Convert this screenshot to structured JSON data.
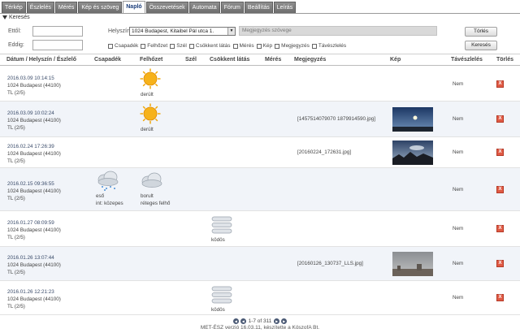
{
  "tabs": [
    {
      "label": "Térkép",
      "active": false
    },
    {
      "label": "Észlelés",
      "active": false
    },
    {
      "label": "Mérés",
      "active": false
    },
    {
      "label": "Kép és szöveg",
      "active": false
    },
    {
      "label": "Napló",
      "active": true
    },
    {
      "label": "Összevetések",
      "active": false
    },
    {
      "label": "Automata",
      "active": false
    },
    {
      "label": "Fórum",
      "active": false
    },
    {
      "label": "Beállítás",
      "active": false
    },
    {
      "label": "Leírás",
      "active": false
    }
  ],
  "search": {
    "header": "Keresés",
    "from_label": "Ettől:",
    "to_label": "Eddig:",
    "from_value": "",
    "to_value": "",
    "location_label": "Helyszín:",
    "location_value": "1024 Budapest, Kitaibel Pál utca 1.",
    "note_placeholder": "Megjegyzés szövege",
    "delete_button": "Törlés",
    "search_button": "Keresés",
    "checkboxes": [
      "Csapadék",
      "Felhőzet",
      "Szél",
      "Csökkent látás",
      "Mérés",
      "Kép",
      "Megjegyzés",
      "Távészlelés"
    ]
  },
  "table": {
    "headers": {
      "date": "Dátum / Helyszín / Észlelő",
      "precip": "Csapadék",
      "cloud": "Felhőzet",
      "wind": "Szél",
      "visibility": "Csökkent látás",
      "measure": "Mérés",
      "note": "Megjegyzés",
      "image": "Kép",
      "remote": "Távészlelés",
      "delete": "Törlés"
    },
    "rows": [
      {
        "date": "2016.03.09 10:14:15",
        "place": "1024 Budapest (44100)",
        "observer": "TL (2/5)",
        "precip": "",
        "precip_sub": "",
        "cloud": "derült",
        "cloud_sub": "",
        "visibility": "",
        "note": "",
        "remote": "Nem",
        "delete": "X",
        "precip_icon": "",
        "cloud_icon": "sun-icon",
        "vis_icon": "",
        "image": ""
      },
      {
        "date": "2016.03.09 10:02:24",
        "place": "1024 Budapest (44100)",
        "observer": "TL (2/5)",
        "precip": "",
        "precip_sub": "",
        "cloud": "derült",
        "cloud_sub": "",
        "visibility": "",
        "note": "[1457514079070 1879914590.jpg]",
        "remote": "Nem",
        "delete": "X",
        "precip_icon": "",
        "cloud_icon": "sun-icon",
        "vis_icon": "",
        "image": "sky-clear"
      },
      {
        "date": "2016.02.24 17:26:39",
        "place": "1024 Budapest (44100)",
        "observer": "TL (2/5)",
        "precip": "",
        "precip_sub": "",
        "cloud": "",
        "cloud_sub": "",
        "visibility": "",
        "note": "[20160224_172631.jpg]",
        "remote": "Nem",
        "delete": "X",
        "precip_icon": "",
        "cloud_icon": "",
        "vis_icon": "",
        "image": "sky-dusk"
      },
      {
        "date": "2016.02.15 09:36:55",
        "place": "1024 Budapest (44100)",
        "observer": "TL (2/5)",
        "precip": "eső",
        "precip_sub": "int: közepes",
        "cloud": "borult",
        "cloud_sub": "réteges felhő",
        "visibility": "",
        "note": "",
        "remote": "Nem",
        "delete": "X",
        "precip_icon": "rain-cloud-icon",
        "cloud_icon": "cloud-icon",
        "vis_icon": "",
        "image": ""
      },
      {
        "date": "2016.01.27 08:09:59",
        "place": "1024 Budapest (44100)",
        "observer": "TL (2/5)",
        "precip": "",
        "precip_sub": "",
        "cloud": "",
        "cloud_sub": "",
        "visibility": "ködös",
        "note": "",
        "remote": "Nem",
        "delete": "X",
        "precip_icon": "",
        "cloud_icon": "",
        "vis_icon": "fog-icon",
        "image": ""
      },
      {
        "date": "2016.01.26 13:07:44",
        "place": "1024 Budapest (44100)",
        "observer": "TL (2/5)",
        "precip": "",
        "precip_sub": "",
        "cloud": "",
        "cloud_sub": "",
        "visibility": "",
        "note": "[20160126_130737_LLS.jpg]",
        "remote": "Nem",
        "delete": "X",
        "precip_icon": "",
        "cloud_icon": "",
        "vis_icon": "",
        "image": "sky-haze"
      },
      {
        "date": "2016.01.26 12:21:23",
        "place": "1024 Budapest (44100)",
        "observer": "TL (2/5)",
        "precip": "",
        "precip_sub": "",
        "cloud": "",
        "cloud_sub": "",
        "visibility": "ködös",
        "note": "",
        "remote": "Nem",
        "delete": "X",
        "precip_icon": "",
        "cloud_icon": "",
        "vis_icon": "fog-icon",
        "image": ""
      }
    ]
  },
  "pager": {
    "text": "1-7 of 311"
  },
  "footer": {
    "text": "MET-ÉSZ verzió 16.03.11, készítette a KöszofA Bt."
  }
}
